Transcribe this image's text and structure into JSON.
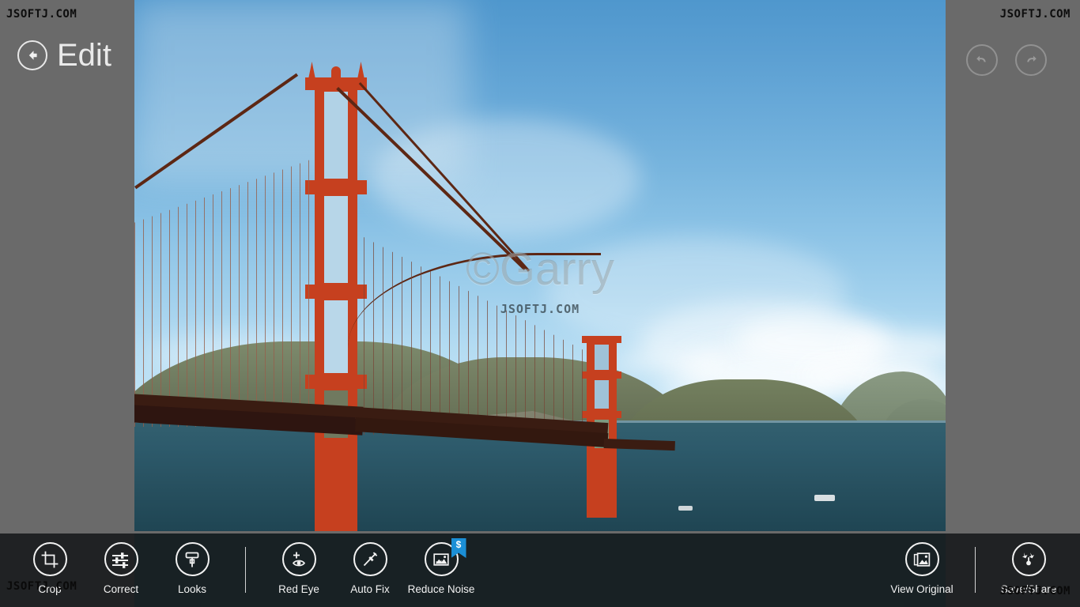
{
  "app": {
    "screen_title": "Edit",
    "background_color": "#6a6a6a"
  },
  "header": {
    "back_label": "Back",
    "title": "Edit"
  },
  "top_actions": [
    {
      "name": "undo",
      "label": "Undo",
      "enabled": false
    },
    {
      "name": "redo",
      "label": "Redo",
      "enabled": false
    }
  ],
  "photo": {
    "alt": "Golden Gate Bridge over San Francisco Bay",
    "watermark_main": "©Garry",
    "watermark_sub": "JSOFTJ.COM"
  },
  "appbar": {
    "left_commands": [
      {
        "id": "crop",
        "label": "Crop",
        "icon": "crop-icon",
        "badge": null
      },
      {
        "id": "correct",
        "label": "Correct",
        "icon": "sliders-icon",
        "badge": null
      },
      {
        "id": "looks",
        "label": "Looks",
        "icon": "paint-roller-icon",
        "badge": null
      },
      {
        "id": "red-eye",
        "label": "Red Eye",
        "icon": "red-eye-icon",
        "badge": null
      },
      {
        "id": "auto-fix",
        "label": "Auto Fix",
        "icon": "magic-wand-icon",
        "badge": null
      },
      {
        "id": "reduce-noise",
        "label": "Reduce Noise",
        "icon": "reduce-noise-icon",
        "badge": "$"
      }
    ],
    "right_commands": [
      {
        "id": "view-original",
        "label": "View Original",
        "icon": "photo-stack-icon"
      },
      {
        "id": "save-share",
        "label": "Save/Share",
        "icon": "share-icon"
      }
    ],
    "badge_color": "#1b8fd6"
  },
  "watermarks": {
    "top_left": "JSOFTJ.COM",
    "top_right": "JSOFTJ.COM",
    "bottom_left": "JSOFTJ.COM",
    "bottom_right": "JSOFTJ.COM"
  }
}
